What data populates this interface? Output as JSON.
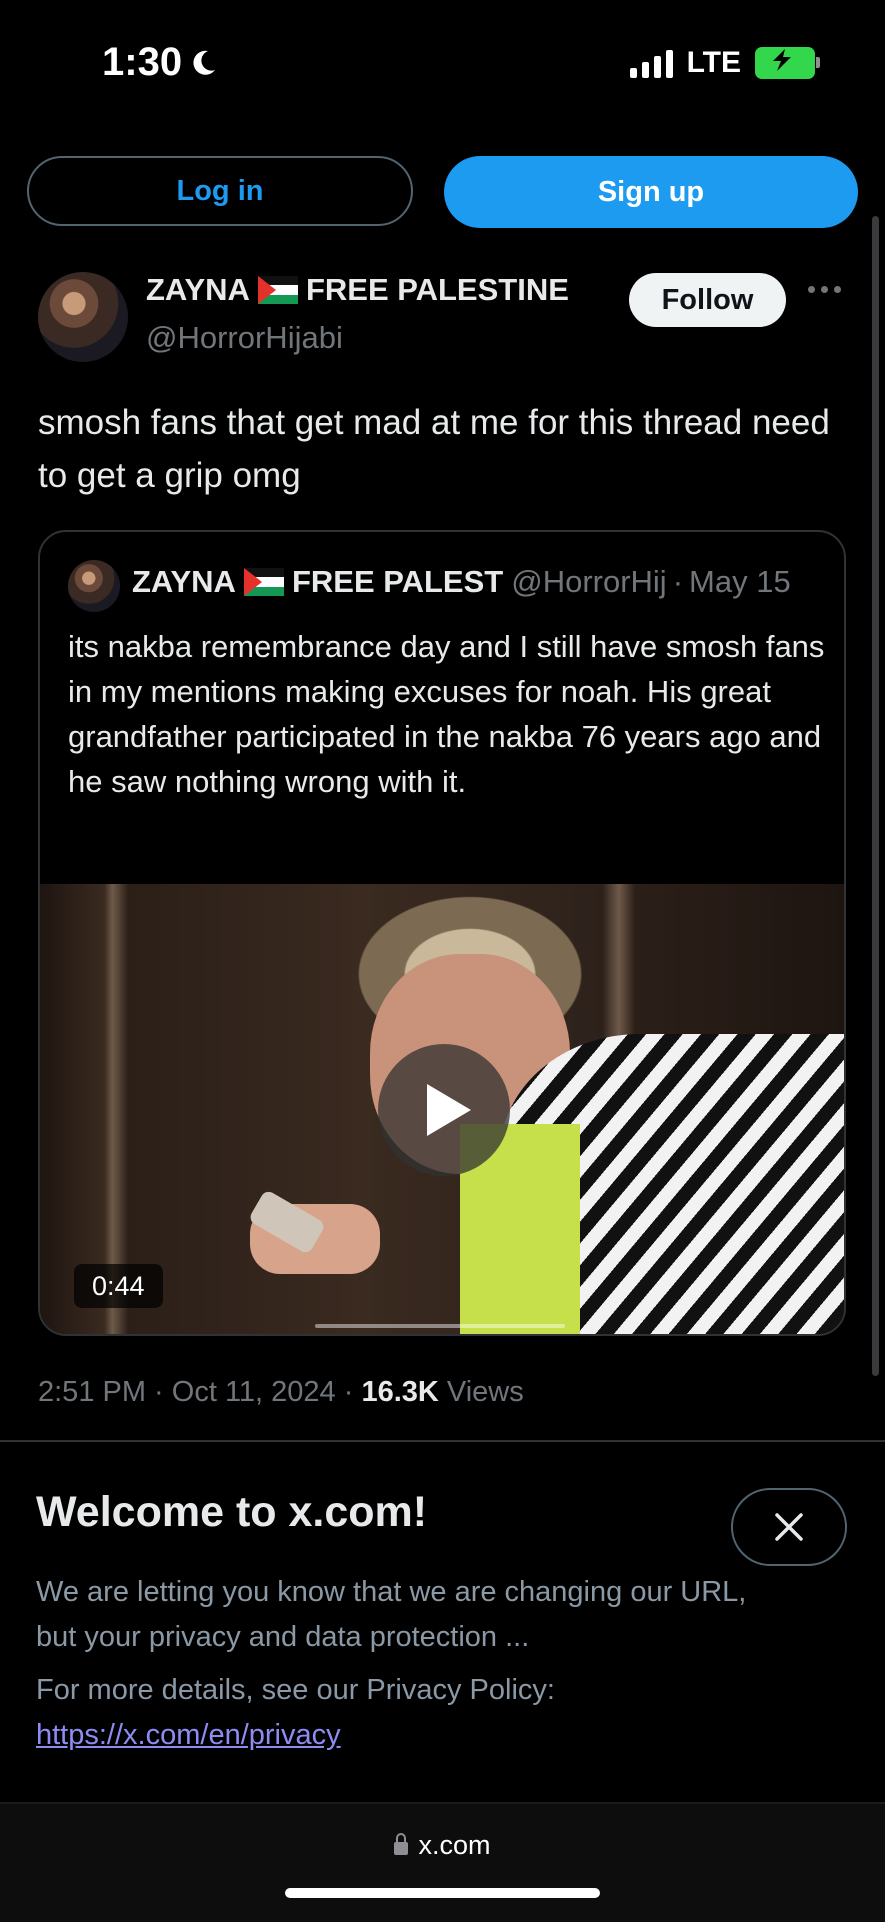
{
  "status_bar": {
    "time": "1:30",
    "network": "LTE"
  },
  "auth": {
    "login_label": "Log in",
    "signup_label": "Sign up"
  },
  "tweet": {
    "display_name": "ZAYNA",
    "display_name_suffix": "FREE PALESTINE",
    "handle": "@HorrorHijabi",
    "follow_label": "Follow",
    "text": "smosh fans that get mad at me for this thread need to get a grip omg",
    "timestamp": "2:51 PM · Oct 11, 2024 · ",
    "views_count": "16.3K",
    "views_label": " Views"
  },
  "quoted_tweet": {
    "display_name": "ZAYNA",
    "display_name_suffix": "FREE PALEST",
    "handle": "@HorrorHij",
    "separator": "·",
    "date": "May 15",
    "text": "its nakba remembrance day and I still have smosh fans in my mentions making excuses for noah. His great grandfather participated in the nakba 76 years ago and he saw nothing wrong with it.",
    "video_duration": "0:44"
  },
  "banner": {
    "title": "Welcome to x.com!",
    "body": "We are letting you know that we are changing our URL, but your privacy and data protection ...",
    "policy_text": "For more details, see our Privacy Policy:",
    "policy_link": "https://x.com/en/privacy"
  },
  "browser": {
    "url": "x.com"
  },
  "colors": {
    "accent": "#1d9bf0",
    "background": "#000000",
    "muted": "#71767b",
    "link": "#8e8cf3"
  }
}
